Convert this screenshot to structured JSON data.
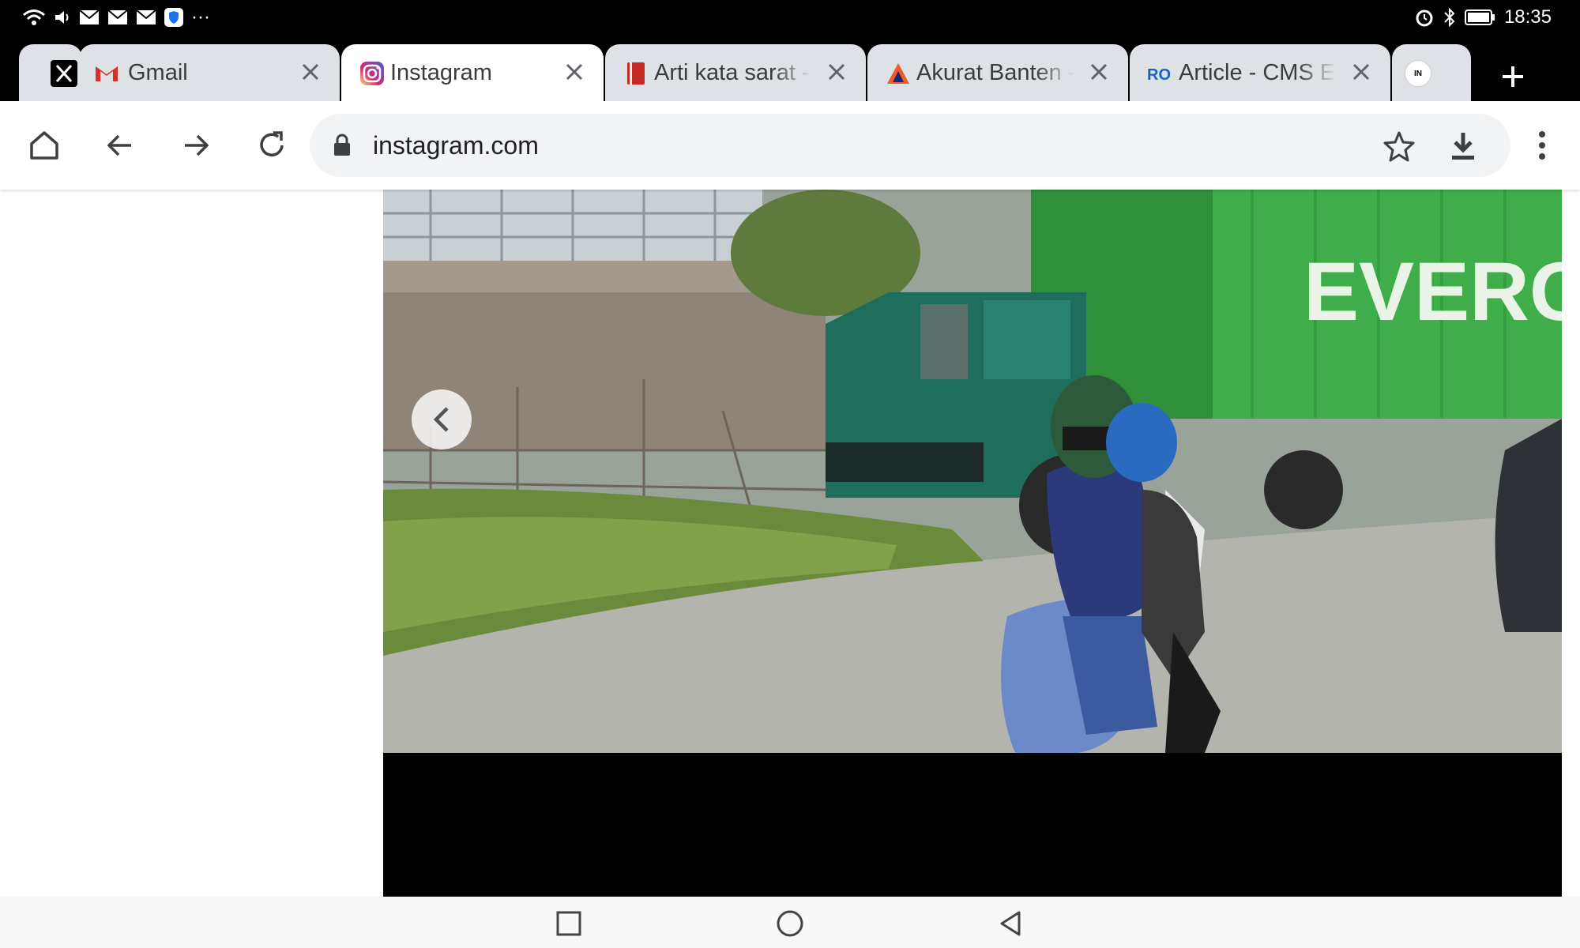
{
  "status_bar": {
    "time": "18:35",
    "left_icons": [
      "wifi-icon",
      "volume-icon",
      "mail-icon",
      "mail-icon",
      "mail-icon",
      "shield-app-icon"
    ],
    "overflow": "···",
    "right_icons": [
      "alarm-icon",
      "bluetooth-icon",
      "battery-icon"
    ]
  },
  "tabs": [
    {
      "title": "Gmail",
      "favicon": "gmail-icon",
      "active": false
    },
    {
      "title": "Instagram",
      "favicon": "instagram-icon",
      "active": true
    },
    {
      "title": "Arti kata sarat -",
      "favicon": "book-icon",
      "active": false
    },
    {
      "title": "Akurat Banten -",
      "favicon": "akurat-icon",
      "active": false
    },
    {
      "title": "Article - CMS E",
      "favicon": "ro-icon",
      "active": false
    }
  ],
  "extra_tab": {
    "favicon_text": "IN"
  },
  "toolbar": {
    "url": "instagram.com"
  },
  "post": {
    "image_alt": "Green truck with EVERGREEN container crashed into roadside fence, motorcyclist passing",
    "container_text": "EVERGR"
  },
  "colors": {
    "status_bar": "#000000",
    "tab_inactive": "#dee1e6",
    "tab_active": "#ffffff",
    "omnibox": "#f1f3f4",
    "container_green": "#3fae4a"
  }
}
